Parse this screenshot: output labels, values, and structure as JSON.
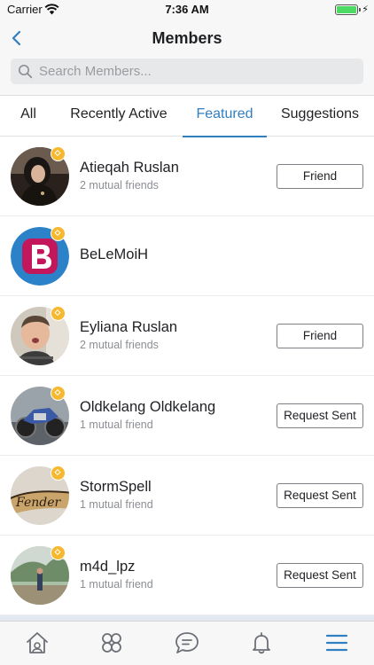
{
  "status_bar": {
    "carrier": "Carrier",
    "time": "7:36 AM",
    "battery_level": 1.0
  },
  "nav": {
    "title": "Members",
    "back_icon": "chevron-left-icon"
  },
  "search": {
    "placeholder": "Search Members...",
    "value": ""
  },
  "tabs": [
    {
      "label": "All"
    },
    {
      "label": "Recently Active"
    },
    {
      "label": "Featured",
      "active": true
    },
    {
      "label": "Suggestions"
    }
  ],
  "members": [
    {
      "name": "Atieqah Ruslan",
      "mutual": "2 mutual friends",
      "action": "Friend"
    },
    {
      "name": "BeLeMoiH",
      "mutual": "",
      "action": ""
    },
    {
      "name": "Eyliana Ruslan",
      "mutual": "2 mutual friends",
      "action": "Friend"
    },
    {
      "name": "Oldkelang Oldkelang",
      "mutual": "1 mutual friend",
      "action": "Request Sent"
    },
    {
      "name": "StormSpell",
      "mutual": "1 mutual friend",
      "action": "Request Sent"
    },
    {
      "name": "m4d_lpz",
      "mutual": "1 mutual friend",
      "action": "Request Sent"
    }
  ],
  "tab_bar": [
    {
      "icon": "home-icon"
    },
    {
      "icon": "groups-icon"
    },
    {
      "icon": "chat-icon"
    },
    {
      "icon": "bell-icon"
    },
    {
      "icon": "menu-icon",
      "active": true
    }
  ],
  "colors": {
    "accent": "#2f7fc1",
    "badge": "#f5b82e",
    "battery": "#4cd964"
  }
}
